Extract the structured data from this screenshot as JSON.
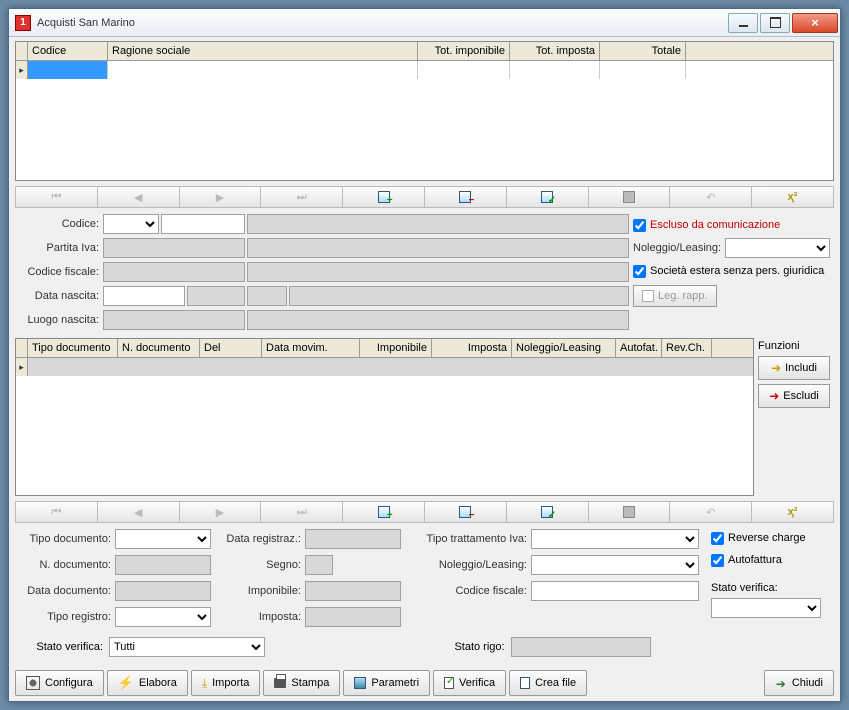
{
  "window": {
    "title": "Acquisti San Marino"
  },
  "grid_top": {
    "columns": [
      "Codice",
      "Ragione sociale",
      "Tot. imponibile",
      "Tot. imposta",
      "Totale"
    ]
  },
  "form_main": {
    "codice_label": "Codice:",
    "partita_iva_label": "Partita Iva:",
    "codice_fiscale_label": "Codice fiscale:",
    "data_nascita_label": "Data nascita:",
    "luogo_nascita_label": "Luogo nascita:",
    "escluso_label": "Escluso da comunicazione",
    "noleggio_leasing_label": "Noleggio/Leasing:",
    "societa_estera_label": "Società estera senza pers. giuridica",
    "leg_rapp_button": "Leg. rapp."
  },
  "grid_mid": {
    "columns": [
      "Tipo documento",
      "N. documento",
      "Del",
      "Data movim.",
      "Imponibile",
      "Imposta",
      "Noleggio/Leasing",
      "Autofat.",
      "Rev.Ch."
    ]
  },
  "side": {
    "title": "Funzioni",
    "includi": "Includi",
    "escludi": "Escludi"
  },
  "form_lower": {
    "tipo_documento_label": "Tipo documento:",
    "n_documento_label": "N. documento:",
    "data_documento_label": "Data documento:",
    "tipo_registro_label": "Tipo registro:",
    "data_registraz_label": "Data registraz.:",
    "segno_label": "Segno:",
    "imponibile_label": "Imponibile:",
    "imposta_label": "Imposta:",
    "tipo_trattamento_iva_label": "Tipo trattamento Iva:",
    "noleggio_leasing_label": "Noleggio/Leasing:",
    "codice_fiscale_label": "Codice fiscale:",
    "reverse_charge_label": "Reverse charge",
    "autofattura_label": "Autofattura",
    "stato_verifica_label": "Stato verifica:"
  },
  "lower_bar": {
    "stato_verifica_label": "Stato verifica:",
    "stato_verifica_value": "Tutti",
    "stato_rigo_label": "Stato rigo:"
  },
  "toolbar": {
    "configura": "Configura",
    "elabora": "Elabora",
    "importa": "Importa",
    "stampa": "Stampa",
    "parametri": "Parametri",
    "verifica": "Verifica",
    "crea_file": "Crea file",
    "chiudi": "Chiudi"
  }
}
